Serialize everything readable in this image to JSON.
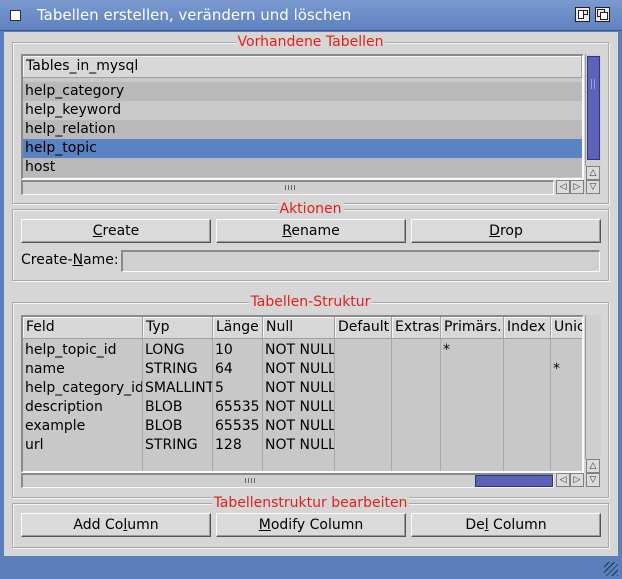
{
  "window": {
    "title": "Tabellen erstellen, verändern und löschen"
  },
  "tables_group": {
    "title": "Vorhandene Tabellen",
    "column": "Tables_in_mysql",
    "items": [
      "help_category",
      "help_keyword",
      "help_relation",
      "help_topic",
      "host"
    ],
    "selected_index": 3
  },
  "actions_group": {
    "title": "Aktionen",
    "create": {
      "pre": "",
      "key": "C",
      "post": "reate"
    },
    "rename": {
      "pre": "",
      "key": "R",
      "post": "ename"
    },
    "drop": {
      "pre": "",
      "key": "D",
      "post": "rop"
    },
    "create_name_label": {
      "pre": "Create-",
      "key": "N",
      "post": "ame:"
    },
    "create_name_value": ""
  },
  "structure_group": {
    "title": "Tabellen-Struktur",
    "columns": [
      "Feld",
      "Typ",
      "Länge",
      "Null",
      "Default",
      "Extras",
      "Primärs.",
      "Index",
      "Unic"
    ],
    "rows": [
      [
        "help_topic_id",
        "LONG",
        "10",
        "NOT NULL",
        "",
        "",
        "*",
        "",
        ""
      ],
      [
        "name",
        "STRING",
        "64",
        "NOT NULL",
        "",
        "",
        "",
        "",
        "*"
      ],
      [
        "help_category_id",
        "SMALLINT",
        "5",
        "NOT NULL",
        "",
        "",
        "",
        "",
        ""
      ],
      [
        "description",
        "BLOB",
        "65535",
        "NOT NULL",
        "",
        "",
        "",
        "",
        ""
      ],
      [
        "example",
        "BLOB",
        "65535",
        "NOT NULL",
        "",
        "",
        "",
        "",
        ""
      ],
      [
        "url",
        "STRING",
        "128",
        "NOT NULL",
        "",
        "",
        "",
        "",
        ""
      ]
    ]
  },
  "edit_group": {
    "title": "Tabellenstruktur bearbeiten",
    "add": {
      "pre": "Add Co",
      "key": "l",
      "post": "umn"
    },
    "modify": {
      "pre": "",
      "key": "M",
      "post": "odify Column"
    },
    "del": {
      "pre": "De",
      "key": "l",
      "post": " Column"
    }
  },
  "colors": {
    "titlebar": "#5f81bf",
    "group_title": "#e0201a",
    "selection": "#5b82c4",
    "scroll_thumb": "#5b62b8"
  }
}
